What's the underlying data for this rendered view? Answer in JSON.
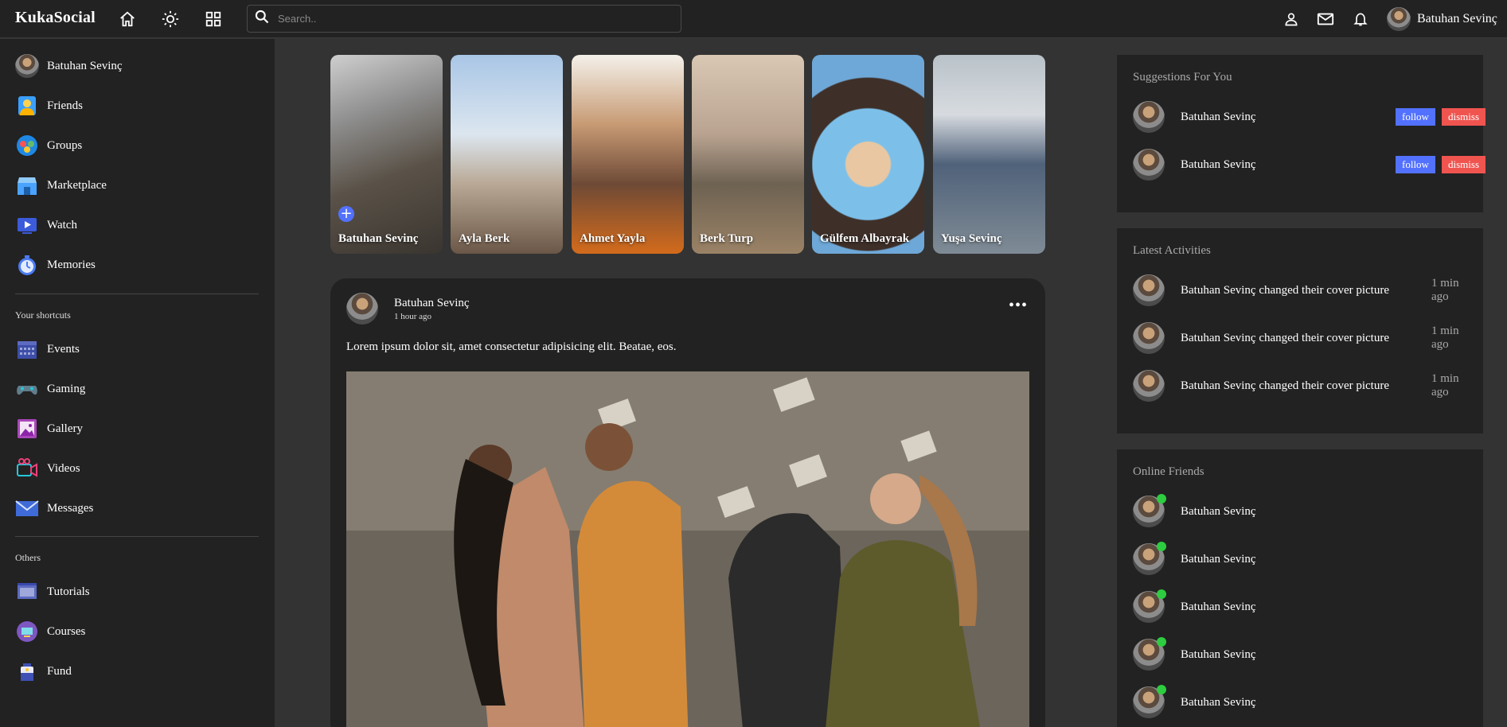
{
  "navbar": {
    "logo": "KukaSocial",
    "search_placeholder": "Search..",
    "user_name": "Batuhan Sevinç"
  },
  "leftbar": {
    "items": [
      {
        "label": "Batuhan Sevinç"
      },
      {
        "label": "Friends"
      },
      {
        "label": "Groups"
      },
      {
        "label": "Marketplace"
      },
      {
        "label": "Watch"
      },
      {
        "label": "Memories"
      }
    ],
    "shortcuts_heading": "Your shortcuts",
    "shortcuts": [
      {
        "label": "Events"
      },
      {
        "label": "Gaming"
      },
      {
        "label": "Gallery"
      },
      {
        "label": "Videos"
      },
      {
        "label": "Messages"
      }
    ],
    "others_heading": "Others",
    "others": [
      {
        "label": "Tutorials"
      },
      {
        "label": "Courses"
      },
      {
        "label": "Fund"
      }
    ]
  },
  "stories": [
    {
      "name": "Batuhan Sevinç"
    },
    {
      "name": "Ayla Berk"
    },
    {
      "name": "Ahmet Yayla"
    },
    {
      "name": "Berk Turp"
    },
    {
      "name": "Gülfem Albayrak"
    },
    {
      "name": "Yuşa Sevinç"
    }
  ],
  "post": {
    "author": "Batuhan Sevinç",
    "time": "1 hour ago",
    "text": "Lorem ipsum dolor sit, amet consectetur adipisicing elit. Beatae, eos.",
    "more": "•••"
  },
  "suggestions": {
    "title": "Suggestions For You",
    "follow_label": "follow",
    "dismiss_label": "dismiss",
    "items": [
      {
        "name": "Batuhan Sevinç"
      },
      {
        "name": "Batuhan Sevinç"
      }
    ]
  },
  "activities": {
    "title": "Latest Activities",
    "items": [
      {
        "name": "Batuhan Sevinç",
        "action": "changed their cover picture",
        "time": "1 min ago"
      },
      {
        "name": "Batuhan Sevinç",
        "action": "changed their cover picture",
        "time": "1 min ago"
      },
      {
        "name": "Batuhan Sevinç",
        "action": "changed their cover picture",
        "time": "1 min ago"
      }
    ]
  },
  "online": {
    "title": "Online Friends",
    "items": [
      {
        "name": "Batuhan Sevinç"
      },
      {
        "name": "Batuhan Sevinç"
      },
      {
        "name": "Batuhan Sevinç"
      },
      {
        "name": "Batuhan Sevinç"
      },
      {
        "name": "Batuhan Sevinç"
      }
    ]
  }
}
